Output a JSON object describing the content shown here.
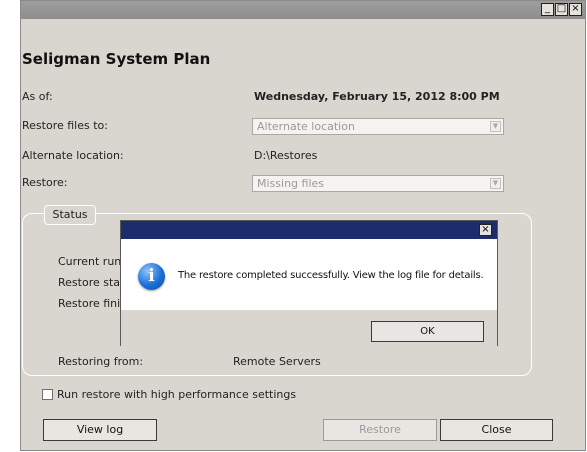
{
  "window": {
    "titlebar_buttons": [
      "_",
      "□",
      "×"
    ],
    "title": "Seligman System Plan"
  },
  "fields": {
    "as_of_label": "As of:",
    "as_of_value": "Wednesday, February 15, 2012 8:00 PM",
    "restore_to_label": "Restore files to:",
    "restore_to_value": "Alternate location",
    "alt_location_label": "Alternate location:",
    "alt_location_value": "D:\\Restores",
    "restore_label": "Restore:",
    "restore_value": "Missing files"
  },
  "status": {
    "tab_label": "Status",
    "current_run_label": "Current run",
    "restore_started_label": "Restore star",
    "restore_finished_label": "Restore finis",
    "restoring_from_label": "Restoring from:",
    "restoring_from_value": "Remote Servers"
  },
  "options": {
    "high_perf_label": "Run restore with high performance settings",
    "high_perf_checked": false
  },
  "buttons": {
    "view_log": "View log",
    "restore": "Restore",
    "close": "Close"
  },
  "dialog": {
    "close_glyph": "×",
    "icon_glyph": "i",
    "message": "The restore completed successfully. View the log file for details.",
    "ok_label": "OK"
  },
  "colors": {
    "window_bg": "#d9d6d0",
    "titlebar": "#8e8e8e",
    "dialog_titlebar": "#1c2d6b",
    "info_icon": "#1c6fd6"
  }
}
